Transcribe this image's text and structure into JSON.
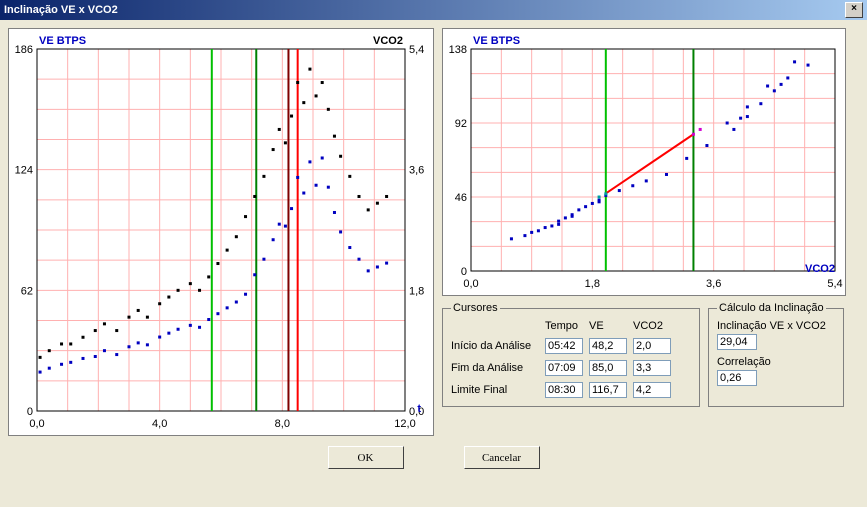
{
  "window": {
    "title": "Inclinação VE x VCO2"
  },
  "chart_data": [
    {
      "type": "scatter",
      "title": "",
      "left_label": "VE BTPS",
      "right_label": "VCO2",
      "xlabel": "t",
      "xlim": [
        0.0,
        12.0
      ],
      "xticks": [
        0.0,
        4.0,
        8.0,
        12.0
      ],
      "left_ylim": [
        0,
        186
      ],
      "left_yticks": [
        0,
        62,
        124,
        186
      ],
      "right_ylim": [
        0.0,
        5.4
      ],
      "right_yticks": [
        0.0,
        1.8,
        3.6,
        5.4
      ],
      "cursors": [
        {
          "name": "inicio",
          "color": "green",
          "x": 5.7
        },
        {
          "name": "fim",
          "color": "darkgreen",
          "x": 7.15
        },
        {
          "name": "limite",
          "color": "red",
          "x": 8.5
        },
        {
          "name": "limite2",
          "color": "darkred",
          "x": 8.2
        }
      ],
      "series": [
        {
          "name": "VE BTPS",
          "axis": "left",
          "color": "blue",
          "points": [
            [
              0.1,
              20
            ],
            [
              0.4,
              22
            ],
            [
              0.8,
              24
            ],
            [
              1.1,
              25
            ],
            [
              1.5,
              27
            ],
            [
              1.9,
              28
            ],
            [
              2.2,
              31
            ],
            [
              2.6,
              29
            ],
            [
              3.0,
              33
            ],
            [
              3.3,
              35
            ],
            [
              3.6,
              34
            ],
            [
              4.0,
              38
            ],
            [
              4.3,
              40
            ],
            [
              4.6,
              42
            ],
            [
              5.0,
              44
            ],
            [
              5.3,
              43
            ],
            [
              5.6,
              47
            ],
            [
              5.9,
              50
            ],
            [
              6.2,
              53
            ],
            [
              6.5,
              56
            ],
            [
              6.8,
              60
            ],
            [
              7.1,
              70
            ],
            [
              7.4,
              78
            ],
            [
              7.7,
              88
            ],
            [
              7.9,
              96
            ],
            [
              8.1,
              95
            ],
            [
              8.3,
              104
            ],
            [
              8.5,
              120
            ],
            [
              8.7,
              112
            ],
            [
              8.9,
              128
            ],
            [
              9.1,
              116
            ],
            [
              9.3,
              130
            ],
            [
              9.5,
              115
            ],
            [
              9.7,
              102
            ],
            [
              9.9,
              92
            ],
            [
              10.2,
              84
            ],
            [
              10.5,
              78
            ],
            [
              10.8,
              72
            ],
            [
              11.1,
              74
            ],
            [
              11.4,
              76
            ]
          ]
        },
        {
          "name": "VCO2",
          "axis": "right",
          "color": "black",
          "points": [
            [
              0.1,
              0.8
            ],
            [
              0.4,
              0.9
            ],
            [
              0.8,
              1.0
            ],
            [
              1.1,
              1.0
            ],
            [
              1.5,
              1.1
            ],
            [
              1.9,
              1.2
            ],
            [
              2.2,
              1.3
            ],
            [
              2.6,
              1.2
            ],
            [
              3.0,
              1.4
            ],
            [
              3.3,
              1.5
            ],
            [
              3.6,
              1.4
            ],
            [
              4.0,
              1.6
            ],
            [
              4.3,
              1.7
            ],
            [
              4.6,
              1.8
            ],
            [
              5.0,
              1.9
            ],
            [
              5.3,
              1.8
            ],
            [
              5.6,
              2.0
            ],
            [
              5.9,
              2.2
            ],
            [
              6.2,
              2.4
            ],
            [
              6.5,
              2.6
            ],
            [
              6.8,
              2.9
            ],
            [
              7.1,
              3.2
            ],
            [
              7.4,
              3.5
            ],
            [
              7.7,
              3.9
            ],
            [
              7.9,
              4.2
            ],
            [
              8.1,
              4.0
            ],
            [
              8.3,
              4.4
            ],
            [
              8.5,
              4.9
            ],
            [
              8.7,
              4.6
            ],
            [
              8.9,
              5.1
            ],
            [
              9.1,
              4.7
            ],
            [
              9.3,
              4.9
            ],
            [
              9.5,
              4.5
            ],
            [
              9.7,
              4.1
            ],
            [
              9.9,
              3.8
            ],
            [
              10.2,
              3.5
            ],
            [
              10.5,
              3.2
            ],
            [
              10.8,
              3.0
            ],
            [
              11.1,
              3.1
            ],
            [
              11.4,
              3.2
            ]
          ]
        }
      ]
    },
    {
      "type": "scatter",
      "title": "",
      "ylabel": "VE BTPS",
      "xlabel": "VCO2",
      "xlim": [
        0.0,
        5.4
      ],
      "xticks": [
        0.0,
        1.8,
        3.6,
        5.4
      ],
      "ylim": [
        0,
        138
      ],
      "yticks": [
        0,
        46,
        92,
        138
      ],
      "cursors": [
        {
          "name": "inicio",
          "color": "green",
          "x": 2.0
        },
        {
          "name": "fim",
          "color": "darkgreen",
          "x": 3.3
        }
      ],
      "fit_line": {
        "x1": 2.0,
        "y1": 48.2,
        "x2": 3.3,
        "y2": 85.0,
        "color": "red"
      },
      "series": [
        {
          "name": "VE vs VCO2",
          "color": "blue",
          "points": [
            [
              0.6,
              20
            ],
            [
              0.8,
              22
            ],
            [
              0.9,
              24
            ],
            [
              1.0,
              25
            ],
            [
              1.1,
              27
            ],
            [
              1.2,
              28
            ],
            [
              1.3,
              31
            ],
            [
              1.3,
              29
            ],
            [
              1.4,
              33
            ],
            [
              1.5,
              35
            ],
            [
              1.5,
              34
            ],
            [
              1.6,
              38
            ],
            [
              1.7,
              40
            ],
            [
              1.8,
              42
            ],
            [
              1.9,
              44
            ],
            [
              1.9,
              43
            ],
            [
              2.0,
              47
            ],
            [
              2.2,
              50
            ],
            [
              2.4,
              53
            ],
            [
              2.6,
              56
            ],
            [
              2.9,
              60
            ],
            [
              3.2,
              70
            ],
            [
              3.5,
              78
            ],
            [
              3.9,
              88
            ],
            [
              4.1,
              96
            ],
            [
              4.0,
              95
            ],
            [
              4.3,
              104
            ],
            [
              4.7,
              120
            ],
            [
              4.5,
              112
            ],
            [
              5.0,
              128
            ],
            [
              4.6,
              116
            ],
            [
              4.8,
              130
            ],
            [
              4.4,
              115
            ],
            [
              4.1,
              102
            ],
            [
              3.8,
              92
            ]
          ]
        },
        {
          "name": "fit-seg-pre",
          "color": "cyan",
          "points": [
            [
              1.9,
              46
            ],
            [
              2.0,
              48
            ]
          ]
        },
        {
          "name": "fit-seg-post",
          "color": "magenta",
          "points": [
            [
              3.3,
              85
            ],
            [
              3.4,
              88
            ]
          ]
        }
      ]
    }
  ],
  "cursores_panel": {
    "legend": "Cursores",
    "col_tempo": "Tempo",
    "col_ve": "VE",
    "col_vco2": "VCO2",
    "rows": {
      "inicio": {
        "label": "Início da Análise",
        "tempo": "05:42",
        "ve": "48,2",
        "vco2": "2,0"
      },
      "fim": {
        "label": "Fim da Análise",
        "tempo": "07:09",
        "ve": "85,0",
        "vco2": "3,3"
      },
      "limite": {
        "label": "Limite Final",
        "tempo": "08:30",
        "ve": "116,7",
        "vco2": "4,2"
      }
    }
  },
  "calc_panel": {
    "legend": "Cálculo da Inclinação",
    "incl_label": "Inclinação VE x VCO2",
    "incl_value": "29,04",
    "corr_label": "Correlação",
    "corr_value": "0,26"
  },
  "buttons": {
    "ok": "OK",
    "cancel": "Cancelar"
  }
}
